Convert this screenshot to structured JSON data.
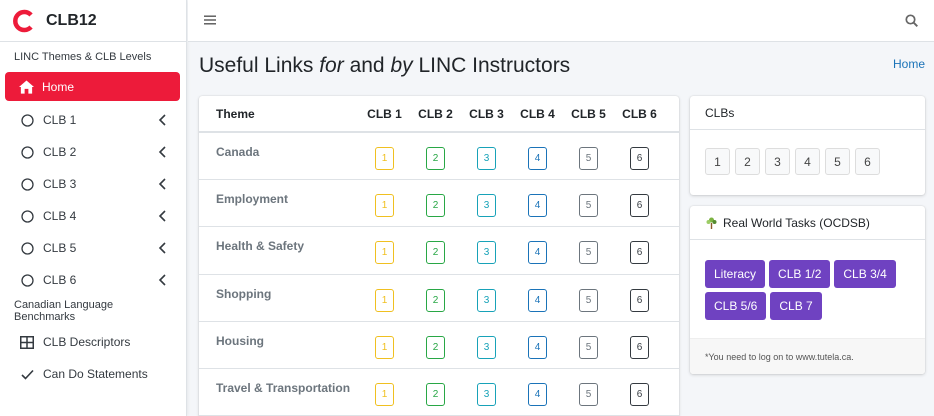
{
  "brand": {
    "name": "CLB12"
  },
  "sidebar": {
    "section1": "LINC Themes & CLB Levels",
    "home": "Home",
    "clb_items": [
      "CLB 1",
      "CLB 2",
      "CLB 3",
      "CLB 4",
      "CLB 5",
      "CLB 6"
    ],
    "section2": "Canadian Language Benchmarks",
    "descriptors": "CLB Descriptors",
    "can_do": "Can Do Statements"
  },
  "header": {
    "title_part1": "Useful Links ",
    "title_for": "for",
    "title_part2": " and ",
    "title_by": "by",
    "title_part3": " LINC Instructors",
    "breadcrumb": "Home"
  },
  "table": {
    "headers": [
      "Theme",
      "CLB 1",
      "CLB 2",
      "CLB 3",
      "CLB 4",
      "CLB 5",
      "CLB 6"
    ],
    "rows": [
      {
        "theme": "Canada",
        "levels": [
          "1",
          "2",
          "3",
          "4",
          "5",
          "6"
        ]
      },
      {
        "theme": "Employment",
        "levels": [
          "1",
          "2",
          "3",
          "4",
          "5",
          "6"
        ]
      },
      {
        "theme": "Health & Safety",
        "levels": [
          "1",
          "2",
          "3",
          "4",
          "5",
          "6"
        ]
      },
      {
        "theme": "Shopping",
        "levels": [
          "1",
          "2",
          "3",
          "4",
          "5",
          "6"
        ]
      },
      {
        "theme": "Housing",
        "levels": [
          "1",
          "2",
          "3",
          "4",
          "5",
          "6"
        ]
      },
      {
        "theme": "Travel & Transportation",
        "levels": [
          "1",
          "2",
          "3",
          "4",
          "5",
          "6"
        ]
      }
    ],
    "level_colors": [
      "#f0c020",
      "#28a745",
      "#17a2b8",
      "#1a73b8",
      "#6c757d",
      "#343a40"
    ]
  },
  "clbs_card": {
    "title": "CLBs",
    "buttons": [
      "1",
      "2",
      "3",
      "4",
      "5",
      "6"
    ]
  },
  "tasks_card": {
    "title": "Real World Tasks (OCDSB)",
    "buttons": [
      "Literacy",
      "CLB 1/2",
      "CLB 3/4",
      "CLB 5/6",
      "CLB 7"
    ],
    "footer": "*You need to log on to www.tutela.ca."
  },
  "colors": {
    "accent": "#ed1b3a",
    "purple": "#6f42c1",
    "link": "#1a73b8"
  }
}
